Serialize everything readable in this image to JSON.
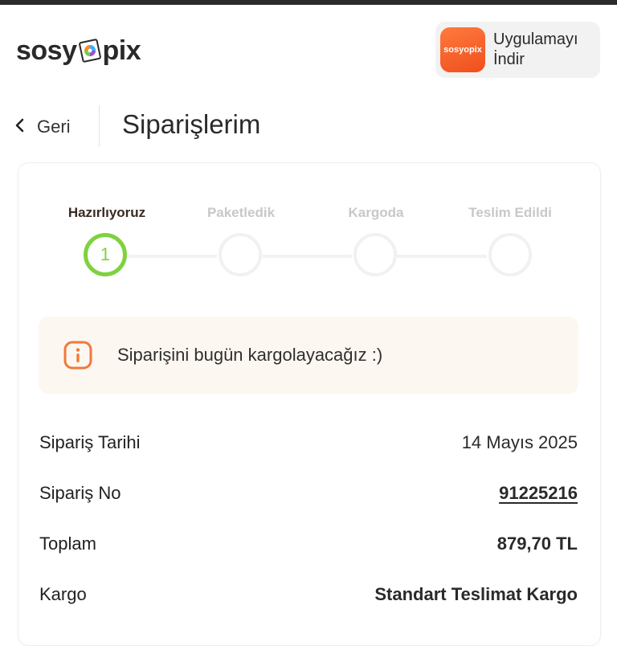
{
  "brand": {
    "logo_prefix": "sosy",
    "logo_suffix": "pix",
    "app_icon_text": "sosyopix",
    "app_cta": "Uygulamayı İndir"
  },
  "header": {
    "back_label": "Geri",
    "title": "Siparişlerim"
  },
  "progress": {
    "steps": [
      {
        "label": "Hazırlıyoruz",
        "marker": "1",
        "active": true
      },
      {
        "label": "Paketledik",
        "marker": "",
        "active": false
      },
      {
        "label": "Kargoda",
        "marker": "",
        "active": false
      },
      {
        "label": "Teslim Edildi",
        "marker": "",
        "active": false
      }
    ],
    "active_color": "#7ed23f"
  },
  "notice": {
    "text": "Siparişini bugün kargolayacağız :)",
    "icon": "info-icon",
    "accent": "#f07a3c"
  },
  "order": {
    "rows": [
      {
        "key": "Sipariş Tarihi",
        "value": "14 Mayıs 2025"
      },
      {
        "key": "Sipariş No",
        "value": "91225216"
      },
      {
        "key": "Toplam",
        "value": "879,70 TL"
      },
      {
        "key": "Kargo",
        "value": "Standart Teslimat Kargo"
      }
    ]
  },
  "colors": {
    "brand_orange": "#f26a2e",
    "notice_bg": "#fdf7f1"
  }
}
